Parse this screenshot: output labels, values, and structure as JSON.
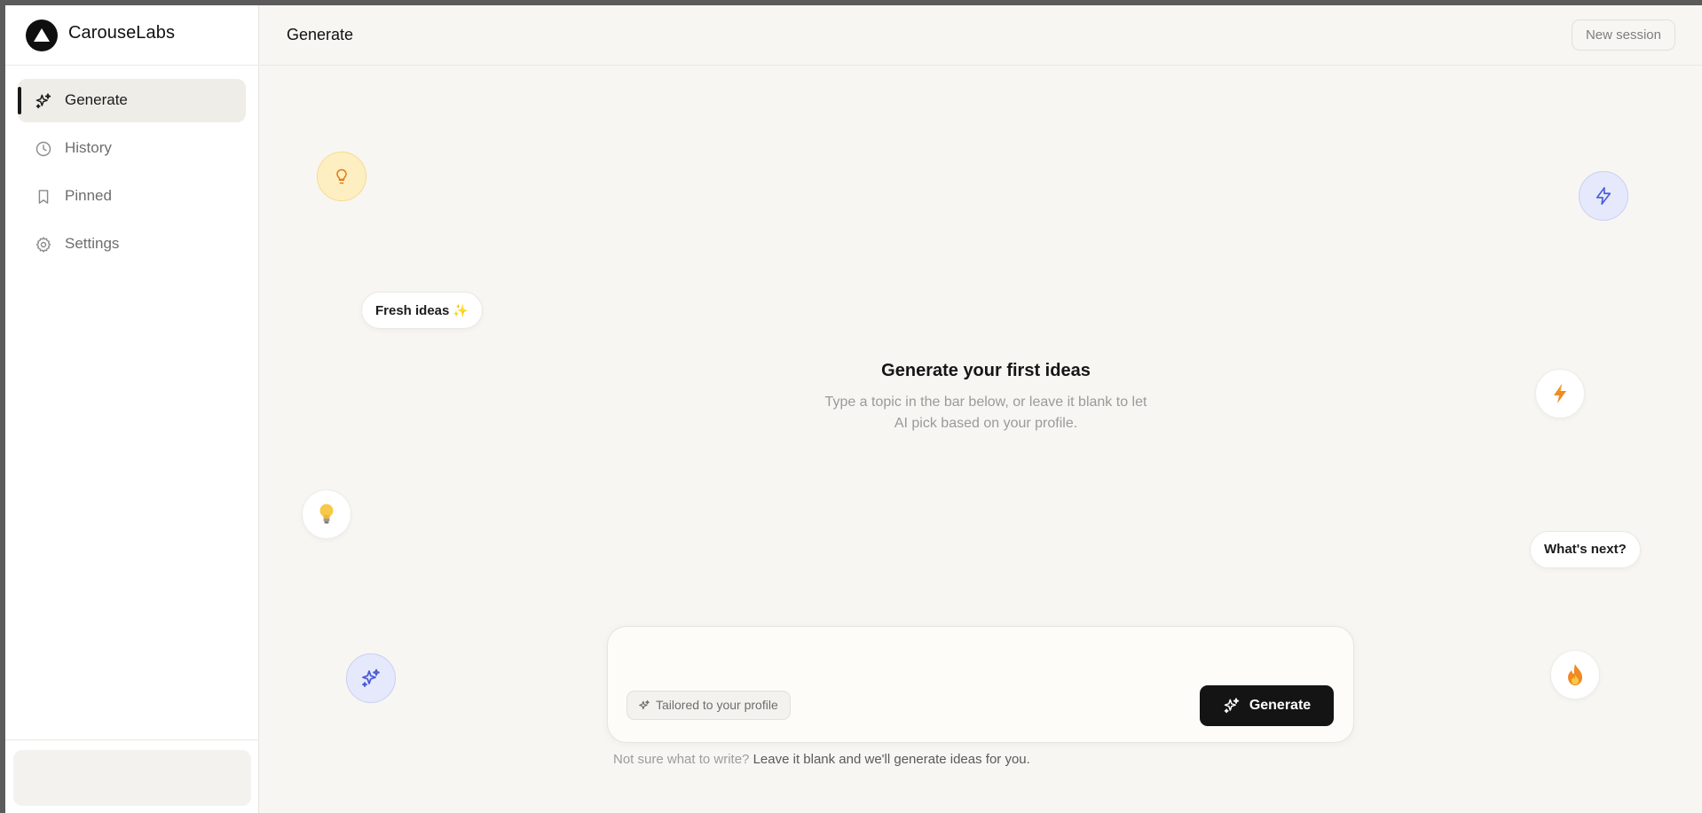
{
  "brand": {
    "name": "CarouseLabs"
  },
  "sidebar": {
    "items": [
      {
        "label": "Generate",
        "icon": "sparkles-icon",
        "active": true
      },
      {
        "label": "History",
        "icon": "clock-icon",
        "active": false
      },
      {
        "label": "Pinned",
        "icon": "bookmark-icon",
        "active": false
      },
      {
        "label": "Settings",
        "icon": "gear-icon",
        "active": false
      }
    ]
  },
  "header": {
    "title": "Generate",
    "new_session_label": "New session"
  },
  "decorations": {
    "fresh_ideas": "Fresh ideas",
    "whats_next": "What's next?"
  },
  "empty_state": {
    "title": "Generate your first ideas",
    "line1": "Type a topic in the bar below, or leave it blank to let",
    "line2": "AI pick based on your profile."
  },
  "composer": {
    "placeholder": "",
    "value": "",
    "tailored_label": "Tailored to your profile",
    "generate_label": "Generate"
  },
  "hint": {
    "prefix": "Not sure what to write?",
    "suffix": "Leave it blank and we'll generate ideas for you."
  },
  "colors": {
    "accent_dark": "#141414",
    "background": "#f7f6f2",
    "bulb_yellow": "#fdefc2",
    "bolt_blue": "#4b5bd6",
    "flame_orange": "#f08a24"
  }
}
